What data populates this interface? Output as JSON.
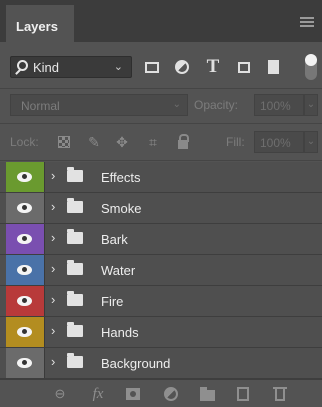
{
  "panel": {
    "tab_title": "Layers",
    "menu_icon": "panel-menu-icon"
  },
  "filter": {
    "kind_label": "Kind",
    "kind_chevron": "⌄",
    "type_glyph": "T",
    "icons": [
      "search-icon",
      "pixel-layer-filter-icon",
      "adjustment-layer-filter-icon",
      "type-layer-filter-icon",
      "shape-layer-filter-icon",
      "smart-object-filter-icon",
      "filter-toggle"
    ]
  },
  "blend": {
    "mode": "Normal",
    "opacity_label": "Opacity:",
    "opacity_value": "100%",
    "chevron": "⌄"
  },
  "lock": {
    "label": "Lock:",
    "fill_label": "Fill:",
    "fill_value": "100%",
    "chevron": "⌄",
    "paint_glyph": "✎",
    "move_glyph": "✥",
    "artboard_glyph": "⌗"
  },
  "layers": [
    {
      "name": "Effects",
      "color": "#6a9a2f"
    },
    {
      "name": "Smoke",
      "color": "#6b6b6b"
    },
    {
      "name": "Bark",
      "color": "#7a4fb0"
    },
    {
      "name": "Water",
      "color": "#4a72a8"
    },
    {
      "name": "Fire",
      "color": "#b83a3a"
    },
    {
      "name": "Hands",
      "color": "#b38d20"
    },
    {
      "name": "Background",
      "color": "#6b6b6b"
    }
  ],
  "layer_row": {
    "expand_glyph": "›"
  },
  "bottom": {
    "link_glyph": "⊖",
    "fx_label": "fx"
  },
  "colors": {
    "panel_bg": "#535353",
    "tabbar_bg": "#3c3c3c",
    "row_bg": "#4f4f4f"
  }
}
